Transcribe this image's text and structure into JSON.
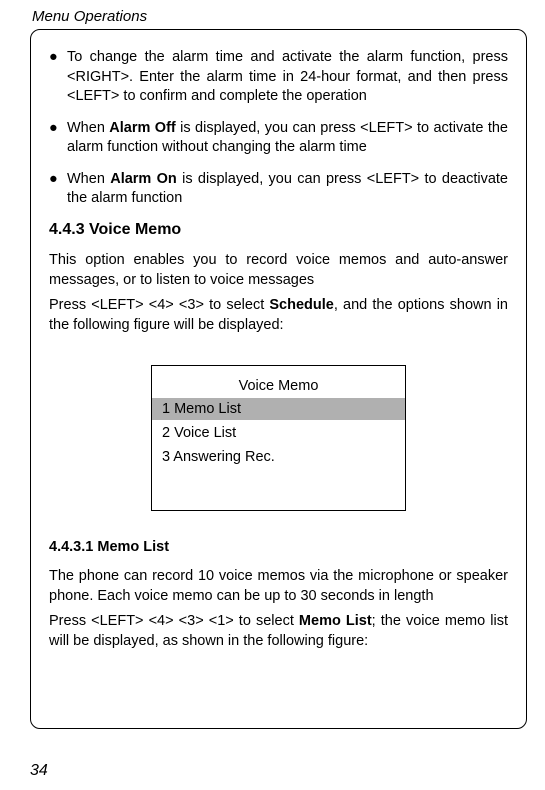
{
  "header": "Menu Operations",
  "bullets": [
    {
      "mark": "●",
      "text": "To change the alarm time and activate the alarm function, press <RIGHT>. Enter the alarm time in 24-hour format, and then press <LEFT> to confirm and complete the operation"
    },
    {
      "mark": "●",
      "prefix": "When ",
      "bold": "Alarm Off",
      "suffix": " is displayed, you can press <LEFT> to activate the alarm function without changing the alarm time"
    },
    {
      "mark": "●",
      "prefix": "When ",
      "bold": "Alarm On",
      "suffix": " is displayed, you can press <LEFT> to deactivate the alarm function"
    }
  ],
  "section_heading": "4.4.3 Voice Memo",
  "section_para1": "This option enables you to record voice memos and auto-answer messages, or to listen to voice messages",
  "section_para2_pre": "Press <LEFT> <4> <3> to select ",
  "section_para2_bold": "Schedule",
  "section_para2_post": ", and the options shown in the following figure will be displayed:",
  "screen": {
    "title": "Voice Memo",
    "items": [
      {
        "label": "1 Memo List",
        "selected": true
      },
      {
        "label": "2 Voice List",
        "selected": false
      },
      {
        "label": "3 Answering Rec.",
        "selected": false
      }
    ]
  },
  "sub_heading": "4.4.3.1 Memo List",
  "sub_para1": "The phone can record 10 voice memos via the microphone or speaker phone. Each voice memo can be up to 30 seconds in length",
  "sub_para2_pre": "Press <LEFT> <4> <3> <1> to select ",
  "sub_para2_bold": "Memo List",
  "sub_para2_post": "; the voice memo list will be displayed, as shown in the following figure:",
  "page_number": "34"
}
